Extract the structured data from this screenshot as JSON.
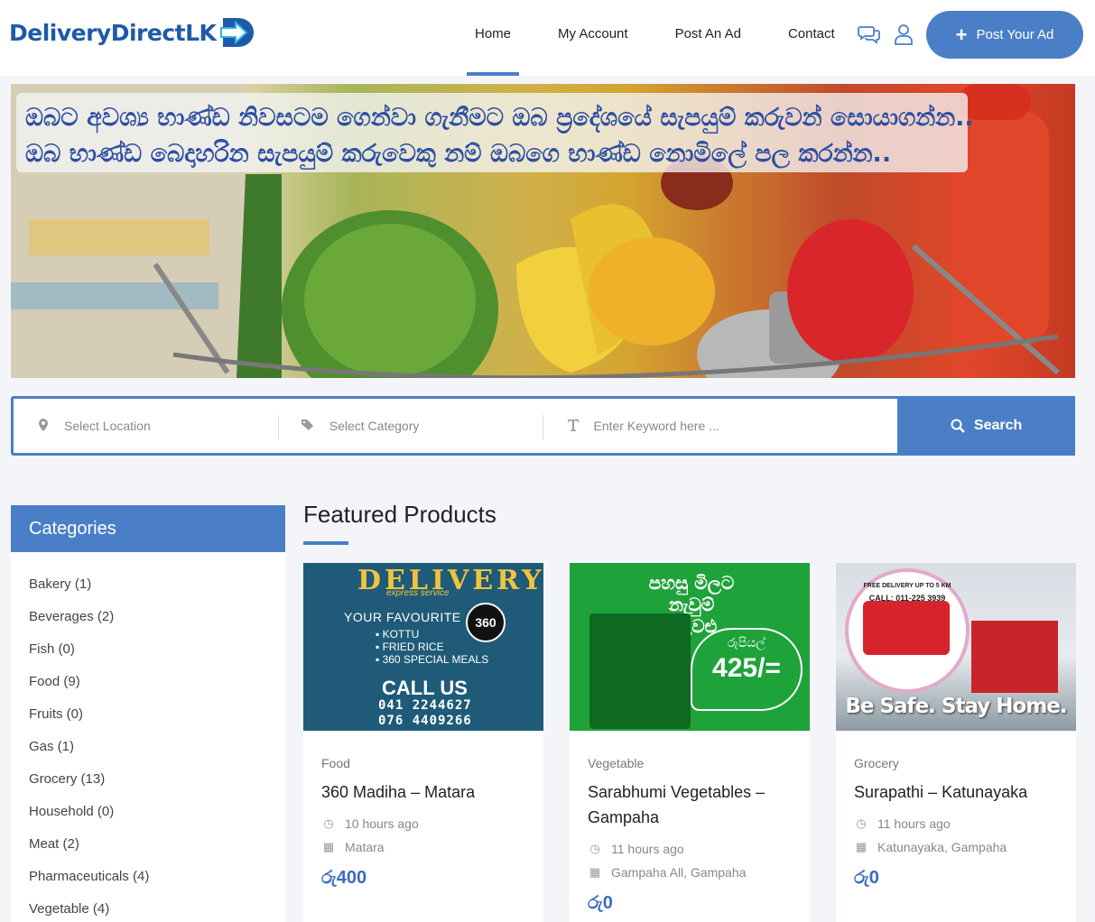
{
  "brand": {
    "name": "DeliveryDirectLK",
    "color": "#1e5aa8",
    "accent": "#4a7fc7"
  },
  "nav": {
    "items": [
      {
        "label": "Home",
        "active": true
      },
      {
        "label": "My Account"
      },
      {
        "label": "Post An Ad"
      },
      {
        "label": "Contact"
      }
    ],
    "chat_icon": "chat-bubbles-icon",
    "user_icon": "user-icon",
    "post_button": "Post Your Ad"
  },
  "hero": {
    "line1": "ඔබට අවශ්‍ය භාණ්ඩ නිවසටම ගෙන්වා ගැනීමට ඔබ ප්‍රදේශයේ සැපයුම් කරුවන් සොයාගන්න..",
    "line2": "ඔබ භාණ්ඩ බෙදාහරින සැපයුම් කරුවෙකු නම් ඔබගෙ භාණ්ඩ නොමිලේ පල කරන්න.."
  },
  "search": {
    "location_placeholder": "Select Location",
    "category_placeholder": "Select Category",
    "keyword_placeholder": "Enter Keyword here ...",
    "button": "Search"
  },
  "categories": {
    "title": "Categories",
    "items": [
      "Bakery (1)",
      "Beverages (2)",
      "Fish (0)",
      "Food (9)",
      "Fruits (0)",
      "Gas (1)",
      "Grocery (13)",
      "Household (0)",
      "Meat (2)",
      "Pharmaceuticals (4)",
      "Vegetable (4)"
    ]
  },
  "featured": {
    "title": "Featured Products",
    "cards": [
      {
        "category": "Food",
        "title": "360 Madiha – Matara",
        "time": "10 hours ago",
        "location": "Matara",
        "price": "රු400",
        "image": {
          "headline": "DELIVERY",
          "tagline": "express service",
          "favourite": "YOUR FAVOURITE",
          "items": [
            "▪ KOTTU",
            "▪ FRIED RICE",
            "▪ 360 SPECIAL MEALS"
          ],
          "call": "CALL US",
          "phones": [
            "041 2244627",
            "076 4409266"
          ],
          "logo": "360"
        }
      },
      {
        "category": "Vegetable",
        "title": "Sarabhumi Vegetables – Gampaha",
        "time": "11 hours ago",
        "location": "Gampaha All, Gampaha",
        "price": "රු0",
        "image": {
          "headline": "පහසු මිලට නැවුම් එළවළු",
          "price_tag": "රුපියල්",
          "price_value": "425/="
        }
      },
      {
        "category": "Grocery",
        "title": "Surapathi – Katunayaka",
        "time": "11 hours ago",
        "location": "Katunayaka, Gampaha",
        "price": "රු0",
        "image": {
          "promo": "FREE DELIVERY UP TO 5 KM",
          "call": "CALL: 011-225 3939",
          "slogan": "Be Safe. Stay Home."
        }
      }
    ]
  }
}
